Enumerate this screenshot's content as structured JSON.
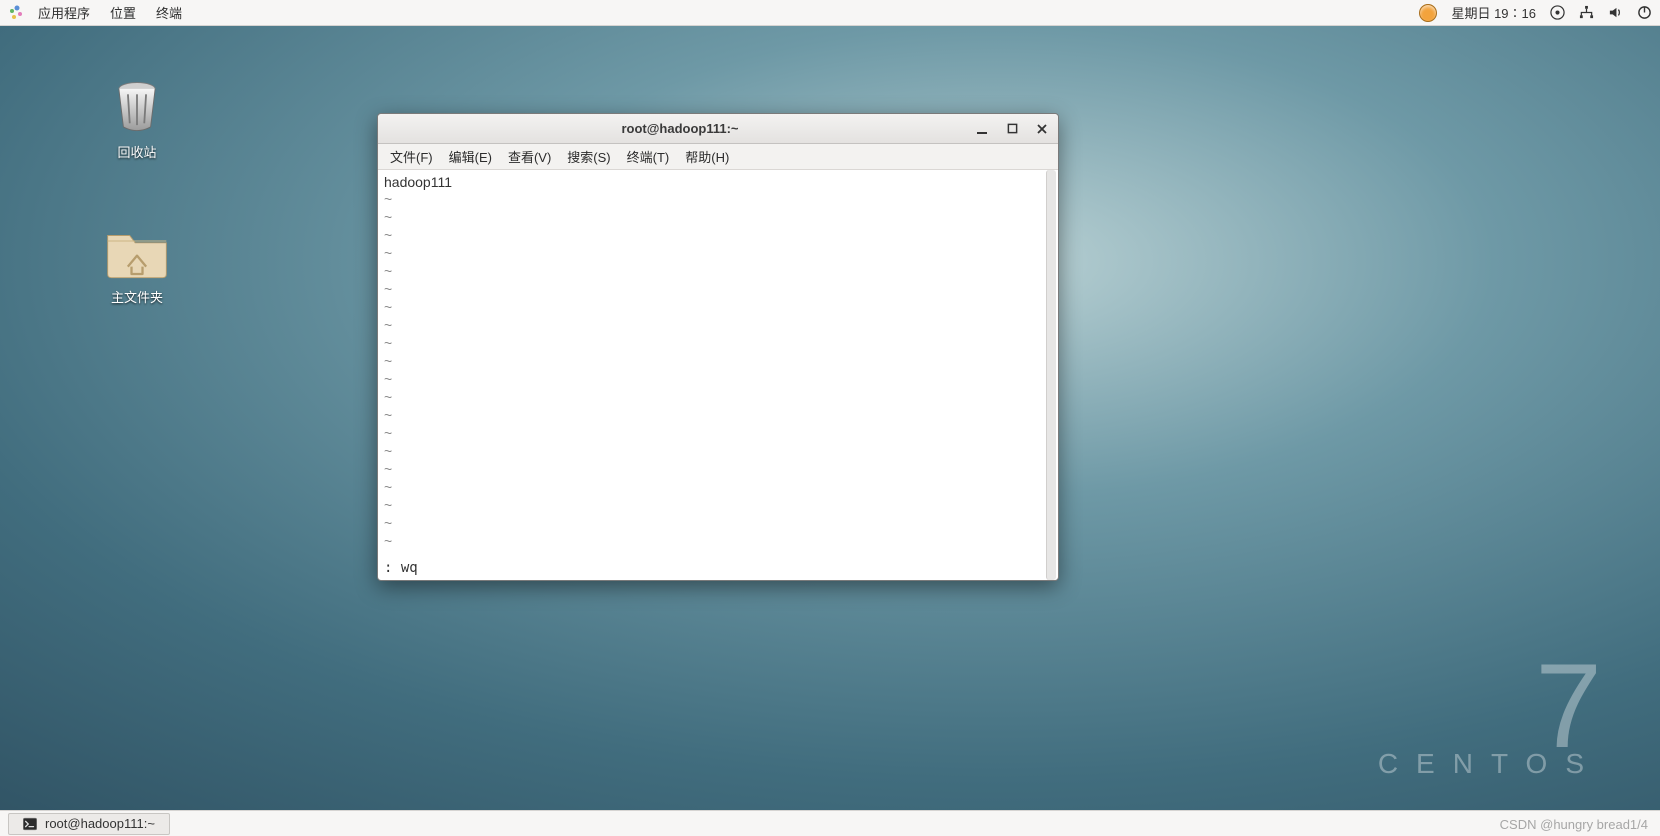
{
  "top_panel": {
    "menus": [
      "应用程序",
      "位置",
      "终端"
    ],
    "clock": "星期日 19∶16"
  },
  "desktop_icons": {
    "trash": "回收站",
    "home": "主文件夹"
  },
  "brand": {
    "name": "CENTOS",
    "version": "7"
  },
  "terminal": {
    "title": "root@hadoop111:~",
    "menus": [
      "文件(F)",
      "编辑(E)",
      "查看(V)",
      "搜索(S)",
      "终端(T)",
      "帮助(H)"
    ],
    "content_first_line": "hadoop111",
    "tilde": "~",
    "command_line": ": wq"
  },
  "taskbar": {
    "task_label": "root@hadoop111:~"
  },
  "watermark_right": "CSDN @hungry bread1/4"
}
